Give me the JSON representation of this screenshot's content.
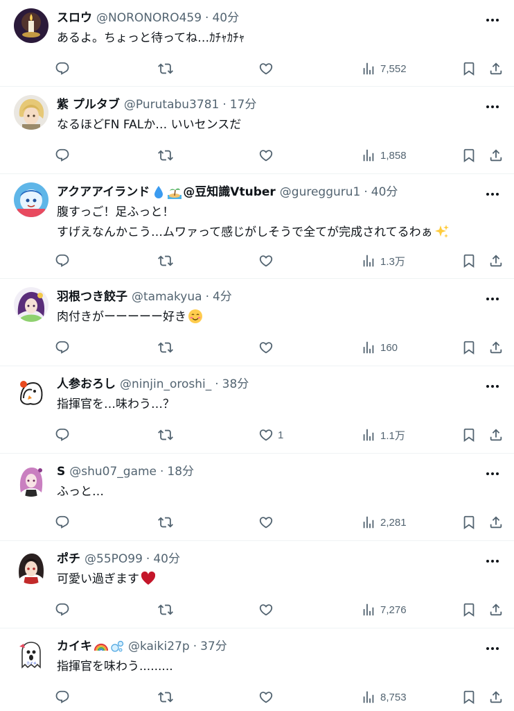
{
  "tweets": [
    {
      "name": "スロウ",
      "handle": "@NORONORO459",
      "time": "40分",
      "lines": [
        "あるよ。ちょっと待ってね…ｶﾁｬｶﾁｬ"
      ],
      "likes": "",
      "views": "7,552",
      "avatar": "candle"
    },
    {
      "name": "紫 プルタブ",
      "handle": "@Purutabu3781",
      "time": "17分",
      "lines": [
        "なるほどFN FALか… いいセンスだ"
      ],
      "likes": "",
      "views": "1,858",
      "avatar": "blonde"
    },
    {
      "name": "アクアアイランド",
      "name_suffix": "@豆知識Vtuber",
      "name_emojis": [
        "droplet",
        "island"
      ],
      "handle": "@guregguru1",
      "time": "40分",
      "lines": [
        "腹すっご！足ふっと！",
        "すげえなんかこう…ムワァって感じがしそうで全てが完成されてるわぁ"
      ],
      "line_end_emoji": "sparkles",
      "likes": "",
      "views": "1.3万",
      "avatar": "aqua"
    },
    {
      "name": "羽根つき餃子",
      "handle": "@tamakyua",
      "time": "4分",
      "lines": [
        "肉付きがーーーーー好き"
      ],
      "line_end_emoji": "smiling-face",
      "likes": "",
      "views": "160",
      "avatar": "purple"
    },
    {
      "name": "人参おろし",
      "handle": "@ninjin_oroshi_",
      "time": "38分",
      "lines": [
        "指揮官を…味わう…？"
      ],
      "likes": "1",
      "views": "1.1万",
      "avatar": "bird"
    },
    {
      "name": "S",
      "handle": "@shu07_game",
      "time": "18分",
      "lines": [
        "ふっと…"
      ],
      "likes": "",
      "views": "2,281",
      "avatar": "pink"
    },
    {
      "name": "ポチ",
      "handle": "@55PO99",
      "time": "40分",
      "lines": [
        "可愛い過ぎます"
      ],
      "line_end_emoji": "red-heart",
      "likes": "",
      "views": "7,276",
      "avatar": "darkhair"
    },
    {
      "name": "カイキ",
      "name_emojis": [
        "rainbow",
        "bubbles"
      ],
      "handle": "@kaiki27p",
      "time": "37分",
      "lines": [
        "指揮官を味わう........."
      ],
      "likes": "",
      "views": "8,753",
      "avatar": "ghost"
    }
  ],
  "icons": {
    "more": "more-dots-icon",
    "reply": "reply-icon",
    "retweet": "retweet-icon",
    "like": "heart-icon",
    "views": "views-bar-chart-icon",
    "bookmark": "bookmark-icon",
    "share": "share-icon"
  },
  "colors": {
    "text": "#0f1419",
    "secondary": "#536471",
    "divider": "#eff3f4"
  }
}
